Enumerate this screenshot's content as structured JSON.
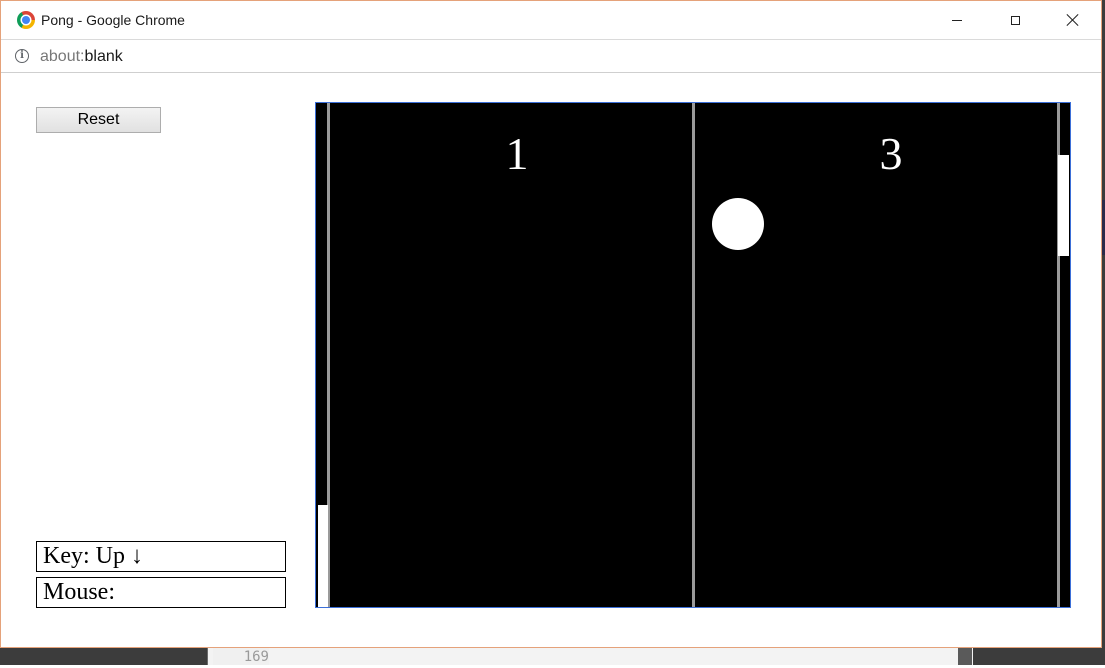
{
  "window": {
    "title": "Pong - Google Chrome"
  },
  "address_bar": {
    "url_scheme": "about:",
    "url_rest": "blank"
  },
  "controls": {
    "reset_label": "Reset",
    "key_label": "Key: Up ↓",
    "mouse_label": "Mouse:"
  },
  "game": {
    "left_score": "1",
    "right_score": "3",
    "left_paddle_position": "bottom",
    "right_paddle_position": "top",
    "colors": {
      "background": "#000000",
      "foreground": "#ffffff",
      "net": "#9a9a9a",
      "canvas_border": "#3b6fd8"
    }
  },
  "background_editor": {
    "line_number": "169"
  },
  "icons": {
    "app": "chrome-icon",
    "info": "info-icon",
    "minimize": "minimize-icon",
    "maximize": "maximize-icon",
    "close": "close-icon"
  }
}
